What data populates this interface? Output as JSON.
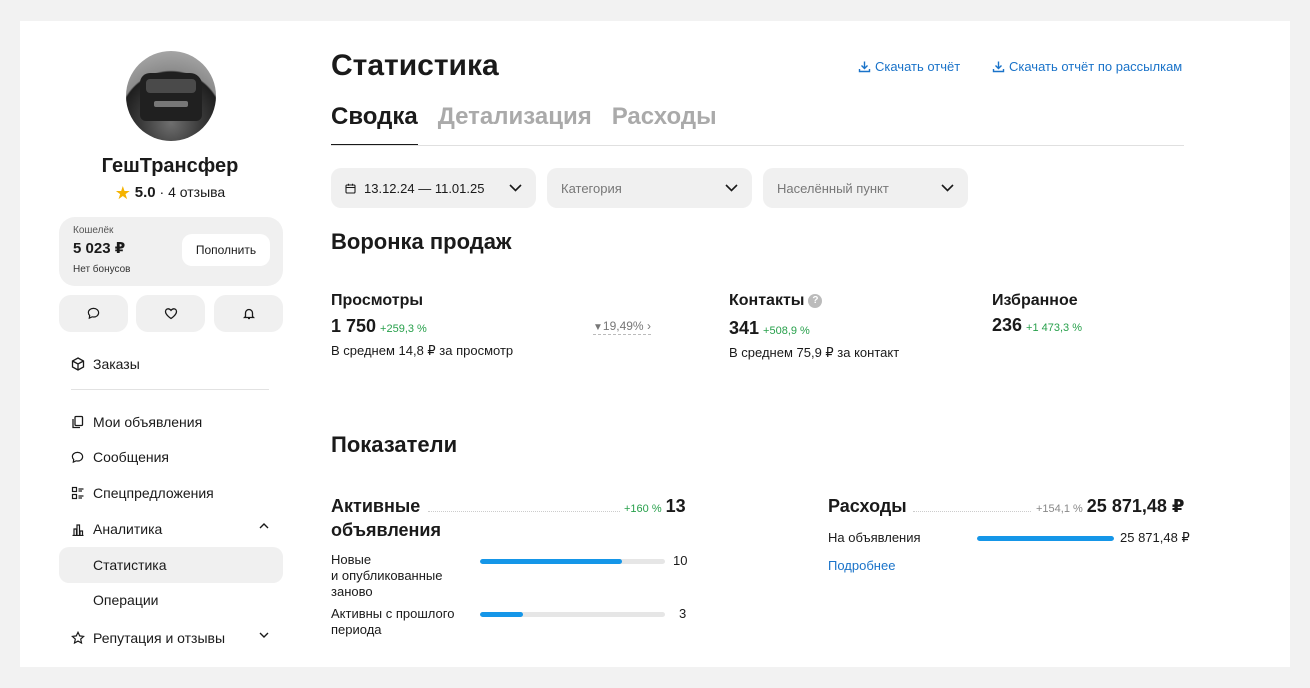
{
  "profile": {
    "name": "ГешТрансфер",
    "rating": "5.0",
    "reviews": "· 4 отзыва"
  },
  "wallet": {
    "label": "Кошелёк",
    "amount": "5 023 ₽",
    "bonus": "Нет бонусов",
    "topup_label": "Пополнить"
  },
  "quick_icons": [
    "chat-icon",
    "heart-icon",
    "bell-icon"
  ],
  "sidebar": {
    "items": [
      {
        "label": "Заказы",
        "icon": "box-icon"
      },
      {
        "label": "Мои объявления",
        "icon": "copy-icon"
      },
      {
        "label": "Сообщения",
        "icon": "chat-icon"
      },
      {
        "label": "Спецпредложения",
        "icon": "list-icon"
      },
      {
        "label": "Аналитика",
        "icon": "chart-icon"
      },
      {
        "label": "Статистика"
      },
      {
        "label": "Операции"
      },
      {
        "label": "Репутация и отзывы",
        "icon": "star-icon"
      }
    ]
  },
  "header": {
    "title": "Статистика",
    "download_report": "Скачать отчёт",
    "download_mail_report": "Скачать отчёт по рассылкам"
  },
  "tabs": [
    {
      "label": "Сводка",
      "active": true
    },
    {
      "label": "Детализация",
      "active": false
    },
    {
      "label": "Расходы",
      "active": false
    }
  ],
  "filters": {
    "date": "13.12.24 — 11.01.25",
    "category_placeholder": "Категория",
    "city_placeholder": "Населённый пункт"
  },
  "funnel": {
    "title": "Воронка продаж",
    "views": {
      "label": "Просмотры",
      "value": "1 750",
      "delta": "+259,3 %",
      "avg": "В среднем 14,8 ₽ за просмотр"
    },
    "conversion": "19,49%",
    "contacts": {
      "label": "Контакты",
      "value": "341",
      "delta": "+508,9 %",
      "avg": "В среднем 75,9 ₽ за контакт"
    },
    "favorites": {
      "label": "Избранное",
      "value": "236",
      "delta": "+1 473,3 %"
    }
  },
  "metrics": {
    "title": "Показатели",
    "active_ads": {
      "title_line1": "Активные",
      "title_line2": "объявления",
      "delta": "+160 %",
      "value": "13",
      "rows": [
        {
          "label_lines": [
            "Новые",
            "и опубликованные",
            "заново"
          ],
          "value": "10",
          "fraction": 0.77
        },
        {
          "label_lines": [
            "Активны с прошлого",
            "периода"
          ],
          "value": "3",
          "fraction": 0.23
        }
      ]
    },
    "expenses": {
      "title": "Расходы",
      "delta": "+154,1 %",
      "value": "25 871,48 ₽",
      "row_label": "На объявления",
      "row_value": "25 871,48 ₽",
      "row_fraction": 1.0,
      "more_label": "Подробнее"
    }
  },
  "colors": {
    "accent": "#1596e8",
    "positive": "#27a04b",
    "link": "#1a73c9"
  }
}
